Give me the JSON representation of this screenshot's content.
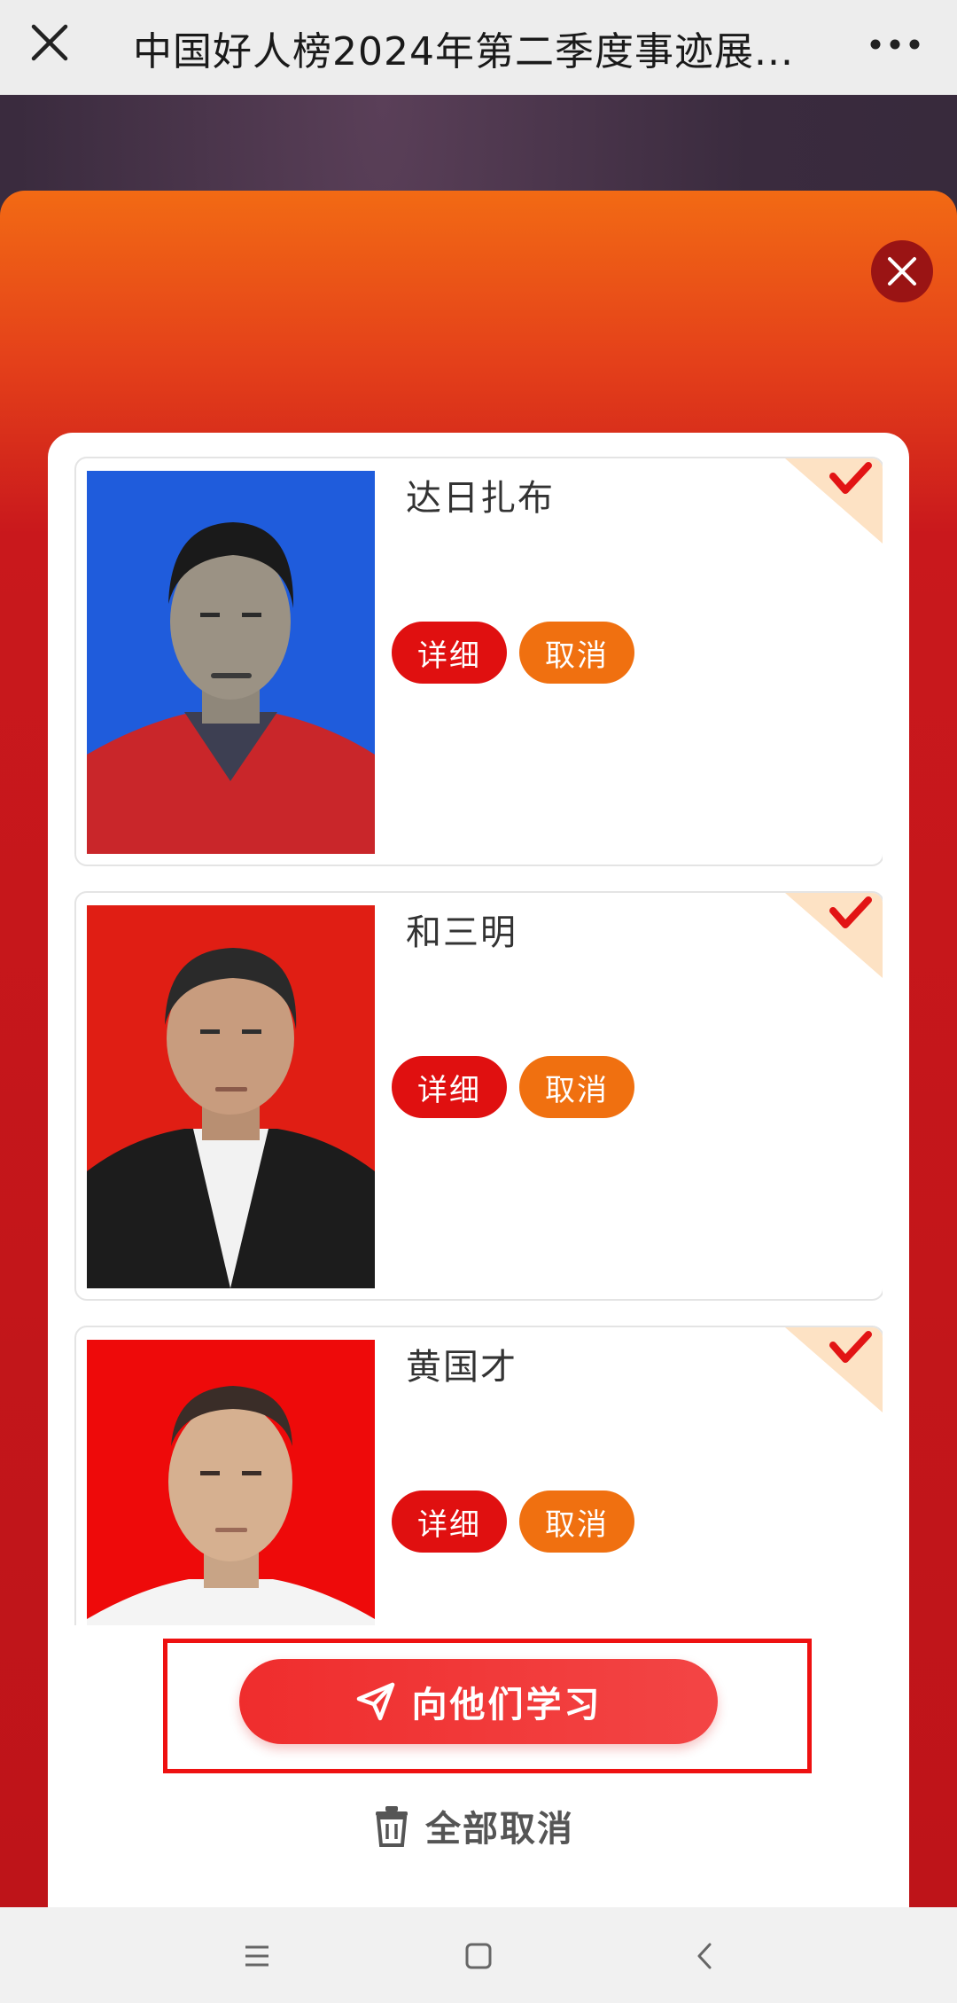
{
  "topbar": {
    "title": "中国好人榜2024年第二季度事迹展..."
  },
  "people": [
    {
      "name": "达日扎布",
      "detail_label": "详细",
      "cancel_label": "取消",
      "selected": true,
      "photo_bg": "#1a55d6",
      "shirt": "#c9262a"
    },
    {
      "name": "和三明",
      "detail_label": "详细",
      "cancel_label": "取消",
      "selected": true,
      "photo_bg": "#e01e14",
      "shirt": "#1c1c1c"
    },
    {
      "name": "黄国才",
      "detail_label": "详细",
      "cancel_label": "取消",
      "selected": true,
      "photo_bg": "#ee0a0a",
      "shirt": "#f4f4f4"
    }
  ],
  "actions": {
    "learn_label": "向他们学习",
    "cancel_all_label": "全部取消"
  },
  "colors": {
    "accent_red": "#e01010",
    "accent_orange": "#f07010",
    "highlight_frame": "#ee1111"
  }
}
